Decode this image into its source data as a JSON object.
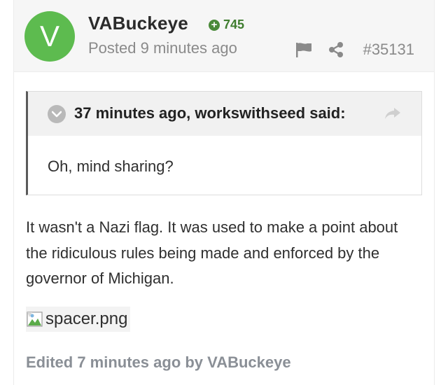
{
  "post": {
    "avatar_letter": "V",
    "author": "VABuckeye",
    "reputation": "745",
    "posted": "Posted 9 minutes ago",
    "post_number": "#35131"
  },
  "quote": {
    "citation": "37 minutes ago, workswithseed said:",
    "text": "Oh, mind sharing?"
  },
  "content": {
    "line1": "It wasn't a Nazi flag.  It was used to make a point about",
    "line2": "the ridiculous rules being made and enforced by the",
    "line3": "governor of Michigan.",
    "image_alt": "spacer.png"
  },
  "footer": {
    "edited": "Edited 7 minutes ago by VABuckeye"
  },
  "icons": {
    "reputation": "plus-circle-icon",
    "flag": "flag-icon",
    "share": "share-icon",
    "collapse": "chevron-down-icon",
    "quote_link": "forward-arrow-icon",
    "image": "broken-image-icon"
  },
  "colors": {
    "avatar": "#5dbb4f",
    "reputation": "#3f7d2f",
    "muted": "#8a8a8a",
    "quote_border": "#5a5a5a"
  }
}
